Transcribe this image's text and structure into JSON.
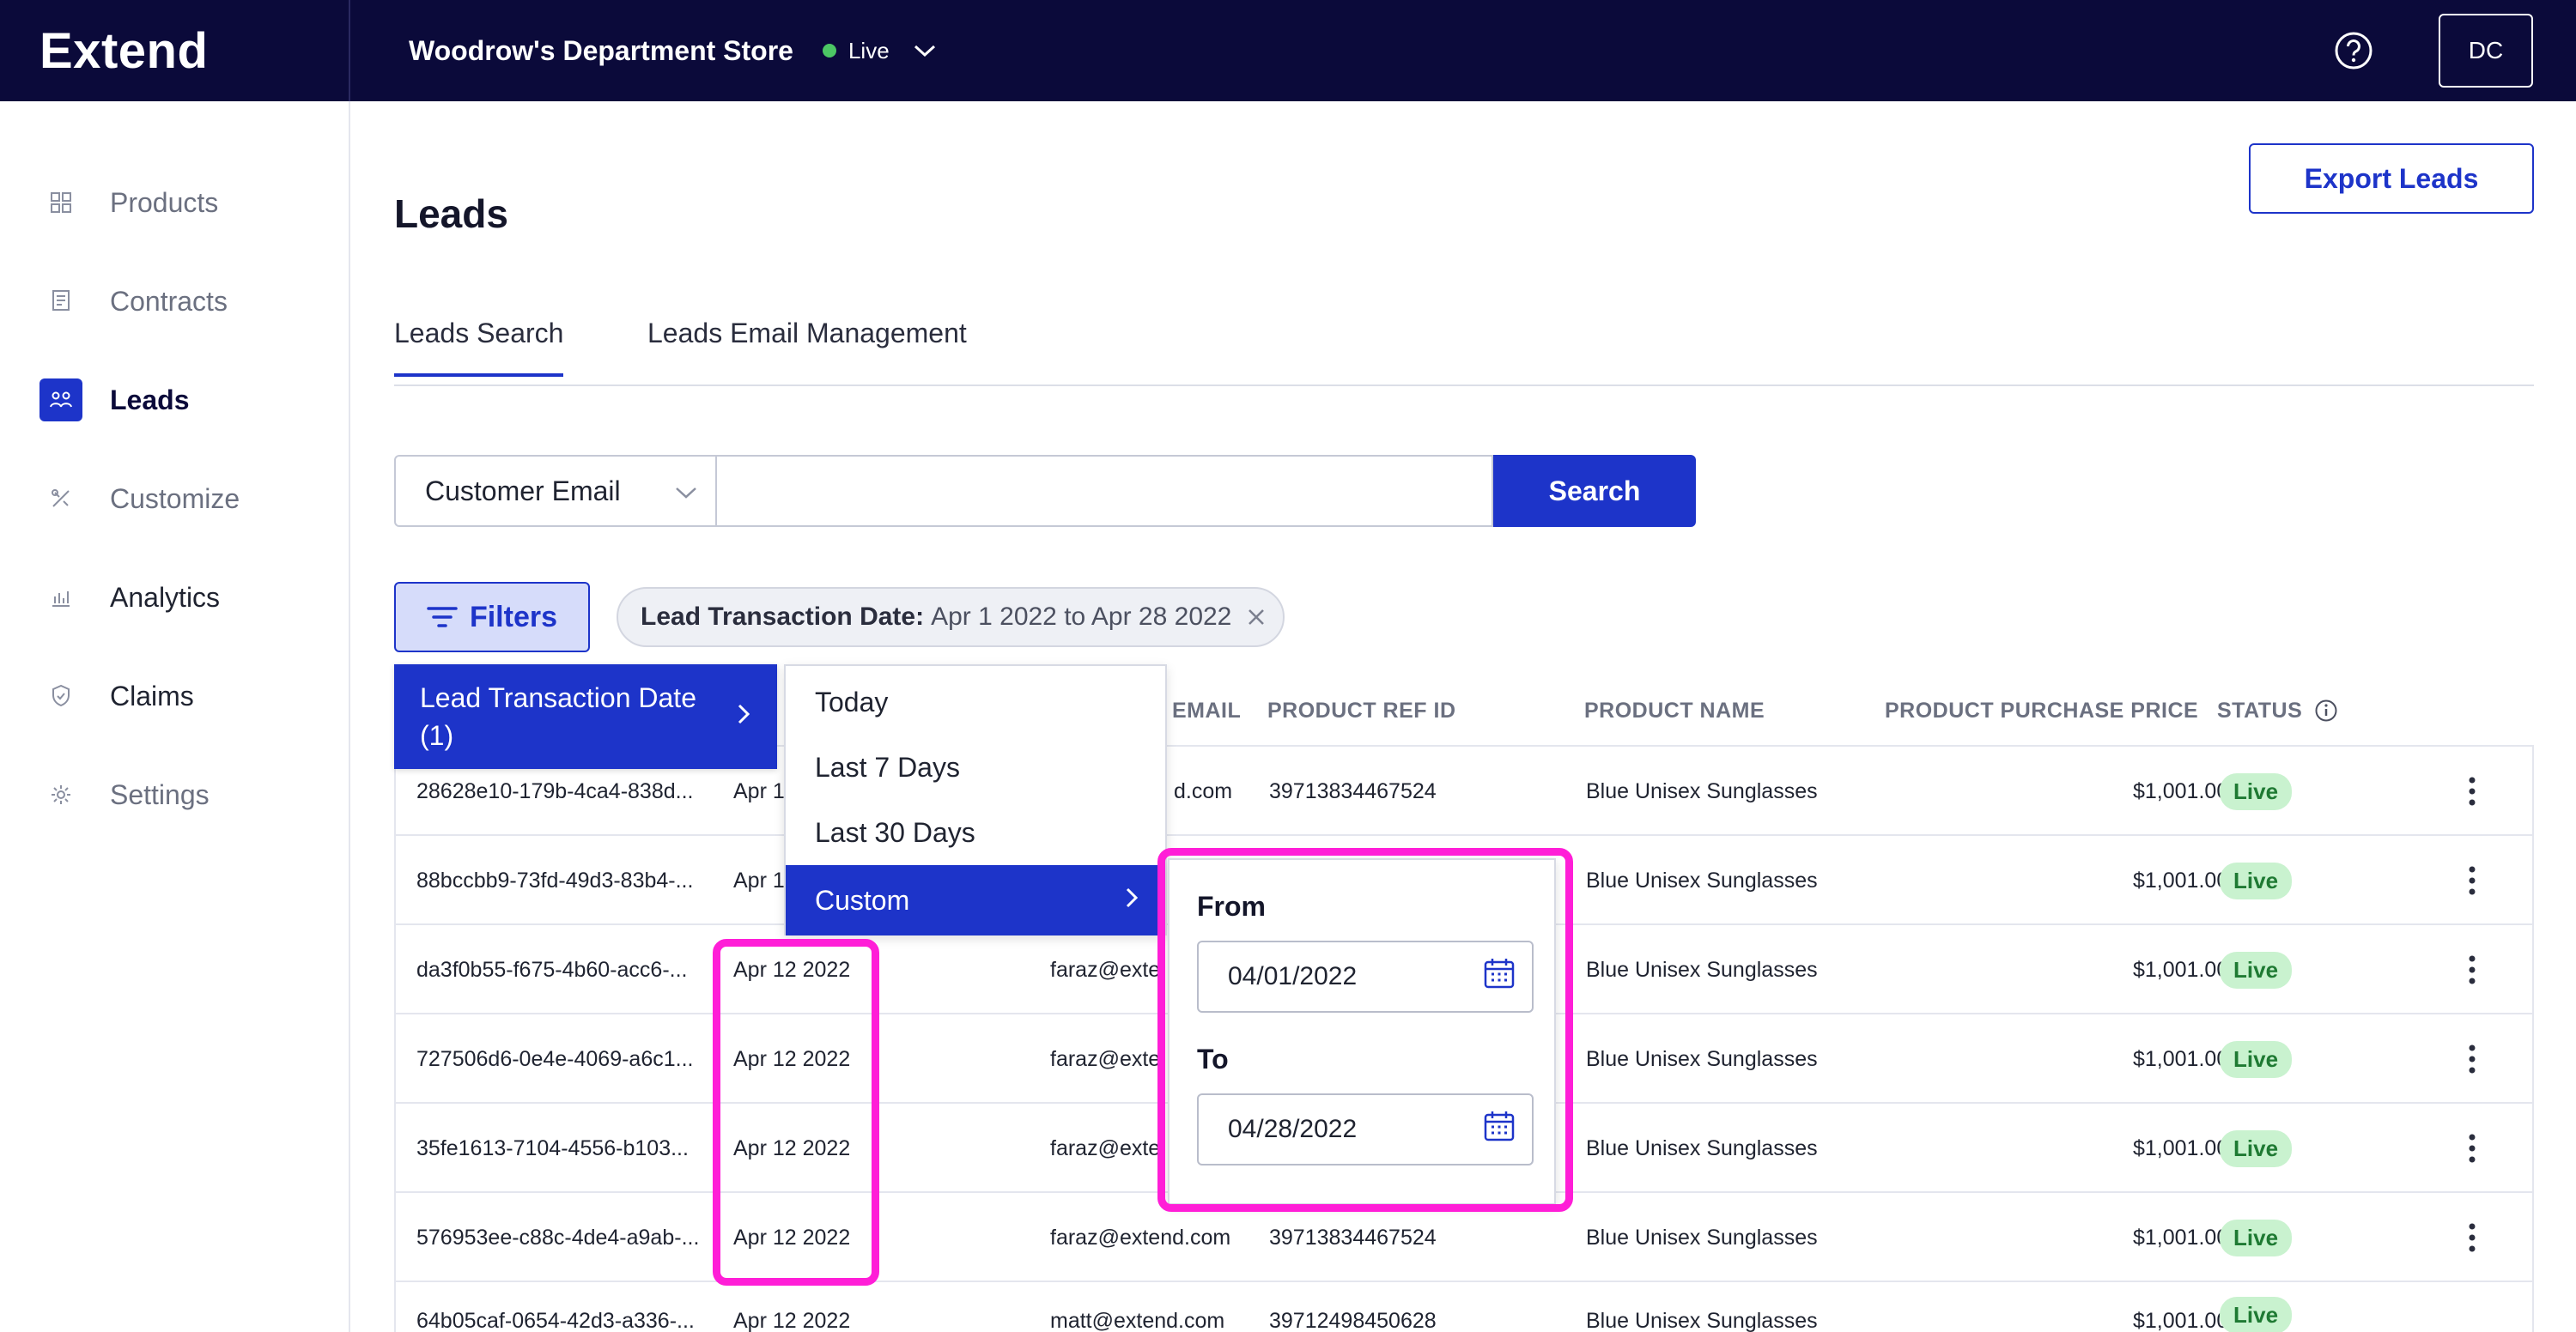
{
  "brand": "Extend",
  "store": {
    "name": "Woodrow's Department Store",
    "status": "Live"
  },
  "user": {
    "initials": "DC"
  },
  "sidebar": {
    "items": [
      {
        "label": "Products",
        "icon": "grid-icon",
        "state": "muted"
      },
      {
        "label": "Contracts",
        "icon": "receipt-icon",
        "state": "muted"
      },
      {
        "label": "Leads",
        "icon": "people-icon",
        "state": "active"
      },
      {
        "label": "Customize",
        "icon": "tools-icon",
        "state": "muted"
      },
      {
        "label": "Analytics",
        "icon": "chart-icon",
        "state": "dark"
      },
      {
        "label": "Claims",
        "icon": "shield-icon",
        "state": "dark"
      },
      {
        "label": "Settings",
        "icon": "gear-icon",
        "state": "muted"
      }
    ]
  },
  "page": {
    "title": "Leads",
    "export_label": "Export Leads"
  },
  "tabs": [
    {
      "label": "Leads Search",
      "active": true
    },
    {
      "label": "Leads Email Management",
      "active": false
    }
  ],
  "search": {
    "field": "Customer Email",
    "value": "",
    "button": "Search"
  },
  "filters": {
    "button": "Filters",
    "chip_label": "Lead Transaction Date:",
    "chip_value": "Apr 1 2022 to Apr 28 2022"
  },
  "table": {
    "headers": [
      "EMAIL",
      "PRODUCT REF ID",
      "PRODUCT NAME",
      "PRODUCT PURCHASE PRICE",
      "STATUS"
    ],
    "rows": [
      {
        "id": "28628e10-179b-4ca4-838d...",
        "date": "Apr 1",
        "email": "d.com",
        "ref": "39713834467524",
        "name": "Blue Unisex Sunglasses",
        "price": "$1,001.00",
        "status": "Live"
      },
      {
        "id": "88bccbb9-73fd-49d3-83b4-...",
        "date": "Apr 1",
        "email": "",
        "ref": "",
        "name": "Blue Unisex Sunglasses",
        "price": "$1,001.00",
        "status": "Live"
      },
      {
        "id": "da3f0b55-f675-4b60-acc6-...",
        "date": "Apr 12 2022",
        "email": "faraz@exte",
        "ref": "",
        "name": "Blue Unisex Sunglasses",
        "price": "$1,001.00",
        "status": "Live"
      },
      {
        "id": "727506d6-0e4e-4069-a6c1...",
        "date": "Apr 12 2022",
        "email": "faraz@exte",
        "ref": "",
        "name": "Blue Unisex Sunglasses",
        "price": "$1,001.00",
        "status": "Live"
      },
      {
        "id": "35fe1613-7104-4556-b103...",
        "date": "Apr 12 2022",
        "email": "faraz@exte",
        "ref": "",
        "name": "Blue Unisex Sunglasses",
        "price": "$1,001.00",
        "status": "Live"
      },
      {
        "id": "576953ee-c88c-4de4-a9ab-...",
        "date": "Apr 12 2022",
        "email": "faraz@extend.com",
        "ref": "39713834467524",
        "name": "Blue Unisex Sunglasses",
        "price": "$1,001.00",
        "status": "Live"
      },
      {
        "id": "64b05caf-0654-42d3-a336-...",
        "date": "Apr 12 2022",
        "email": "matt@extend.com",
        "ref": "39712498450628",
        "name": "Blue Unisex Sunglasses",
        "price": "$1,001.00",
        "status": "Live"
      }
    ]
  },
  "menu": {
    "level1": "Lead Transaction Date (1)",
    "level2": [
      "Today",
      "Last 7 Days",
      "Last 30 Days",
      "Custom"
    ],
    "date_from_label": "From",
    "date_from": "04/01/2022",
    "date_to_label": "To",
    "date_to": "04/28/2022"
  },
  "colors": {
    "navy": "#0b0a3a",
    "accent": "#1d34c9",
    "highlight": "#ff1ed7",
    "live": "#4cc764"
  }
}
